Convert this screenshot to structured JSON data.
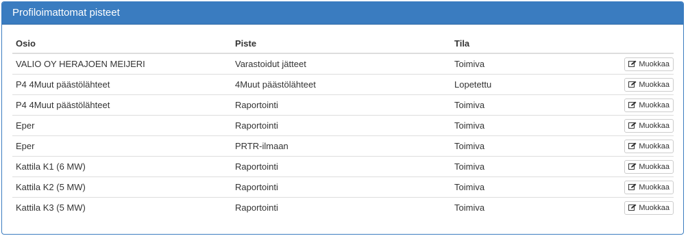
{
  "panel": {
    "title": "Profiloimattomat pisteet"
  },
  "table": {
    "headers": {
      "osio": "Osio",
      "piste": "Piste",
      "tila": "Tila"
    },
    "edit_label": "Muokkaa",
    "edit_icon": "edit-icon",
    "rows": [
      {
        "osio": "VALIO OY HERAJOEN MEIJERI",
        "piste": "Varastoidut jätteet",
        "tila": "Toimiva"
      },
      {
        "osio": "P4 4Muut päästölähteet",
        "piste": "4Muut päästölähteet",
        "tila": "Lopetettu"
      },
      {
        "osio": "P4 4Muut päästölähteet",
        "piste": "Raportointi",
        "tila": "Toimiva"
      },
      {
        "osio": "Eper",
        "piste": "Raportointi",
        "tila": "Toimiva"
      },
      {
        "osio": "Eper",
        "piste": "PRTR-ilmaan",
        "tila": "Toimiva"
      },
      {
        "osio": "Kattila K1 (6 MW)",
        "piste": "Raportointi",
        "tila": "Toimiva"
      },
      {
        "osio": "Kattila K2 (5 MW)",
        "piste": "Raportointi",
        "tila": "Toimiva"
      },
      {
        "osio": "Kattila K3 (5 MW)",
        "piste": "Raportointi",
        "tila": "Toimiva"
      }
    ]
  },
  "colors": {
    "header_bg": "#3a7cc0",
    "border": "#dddddd"
  }
}
